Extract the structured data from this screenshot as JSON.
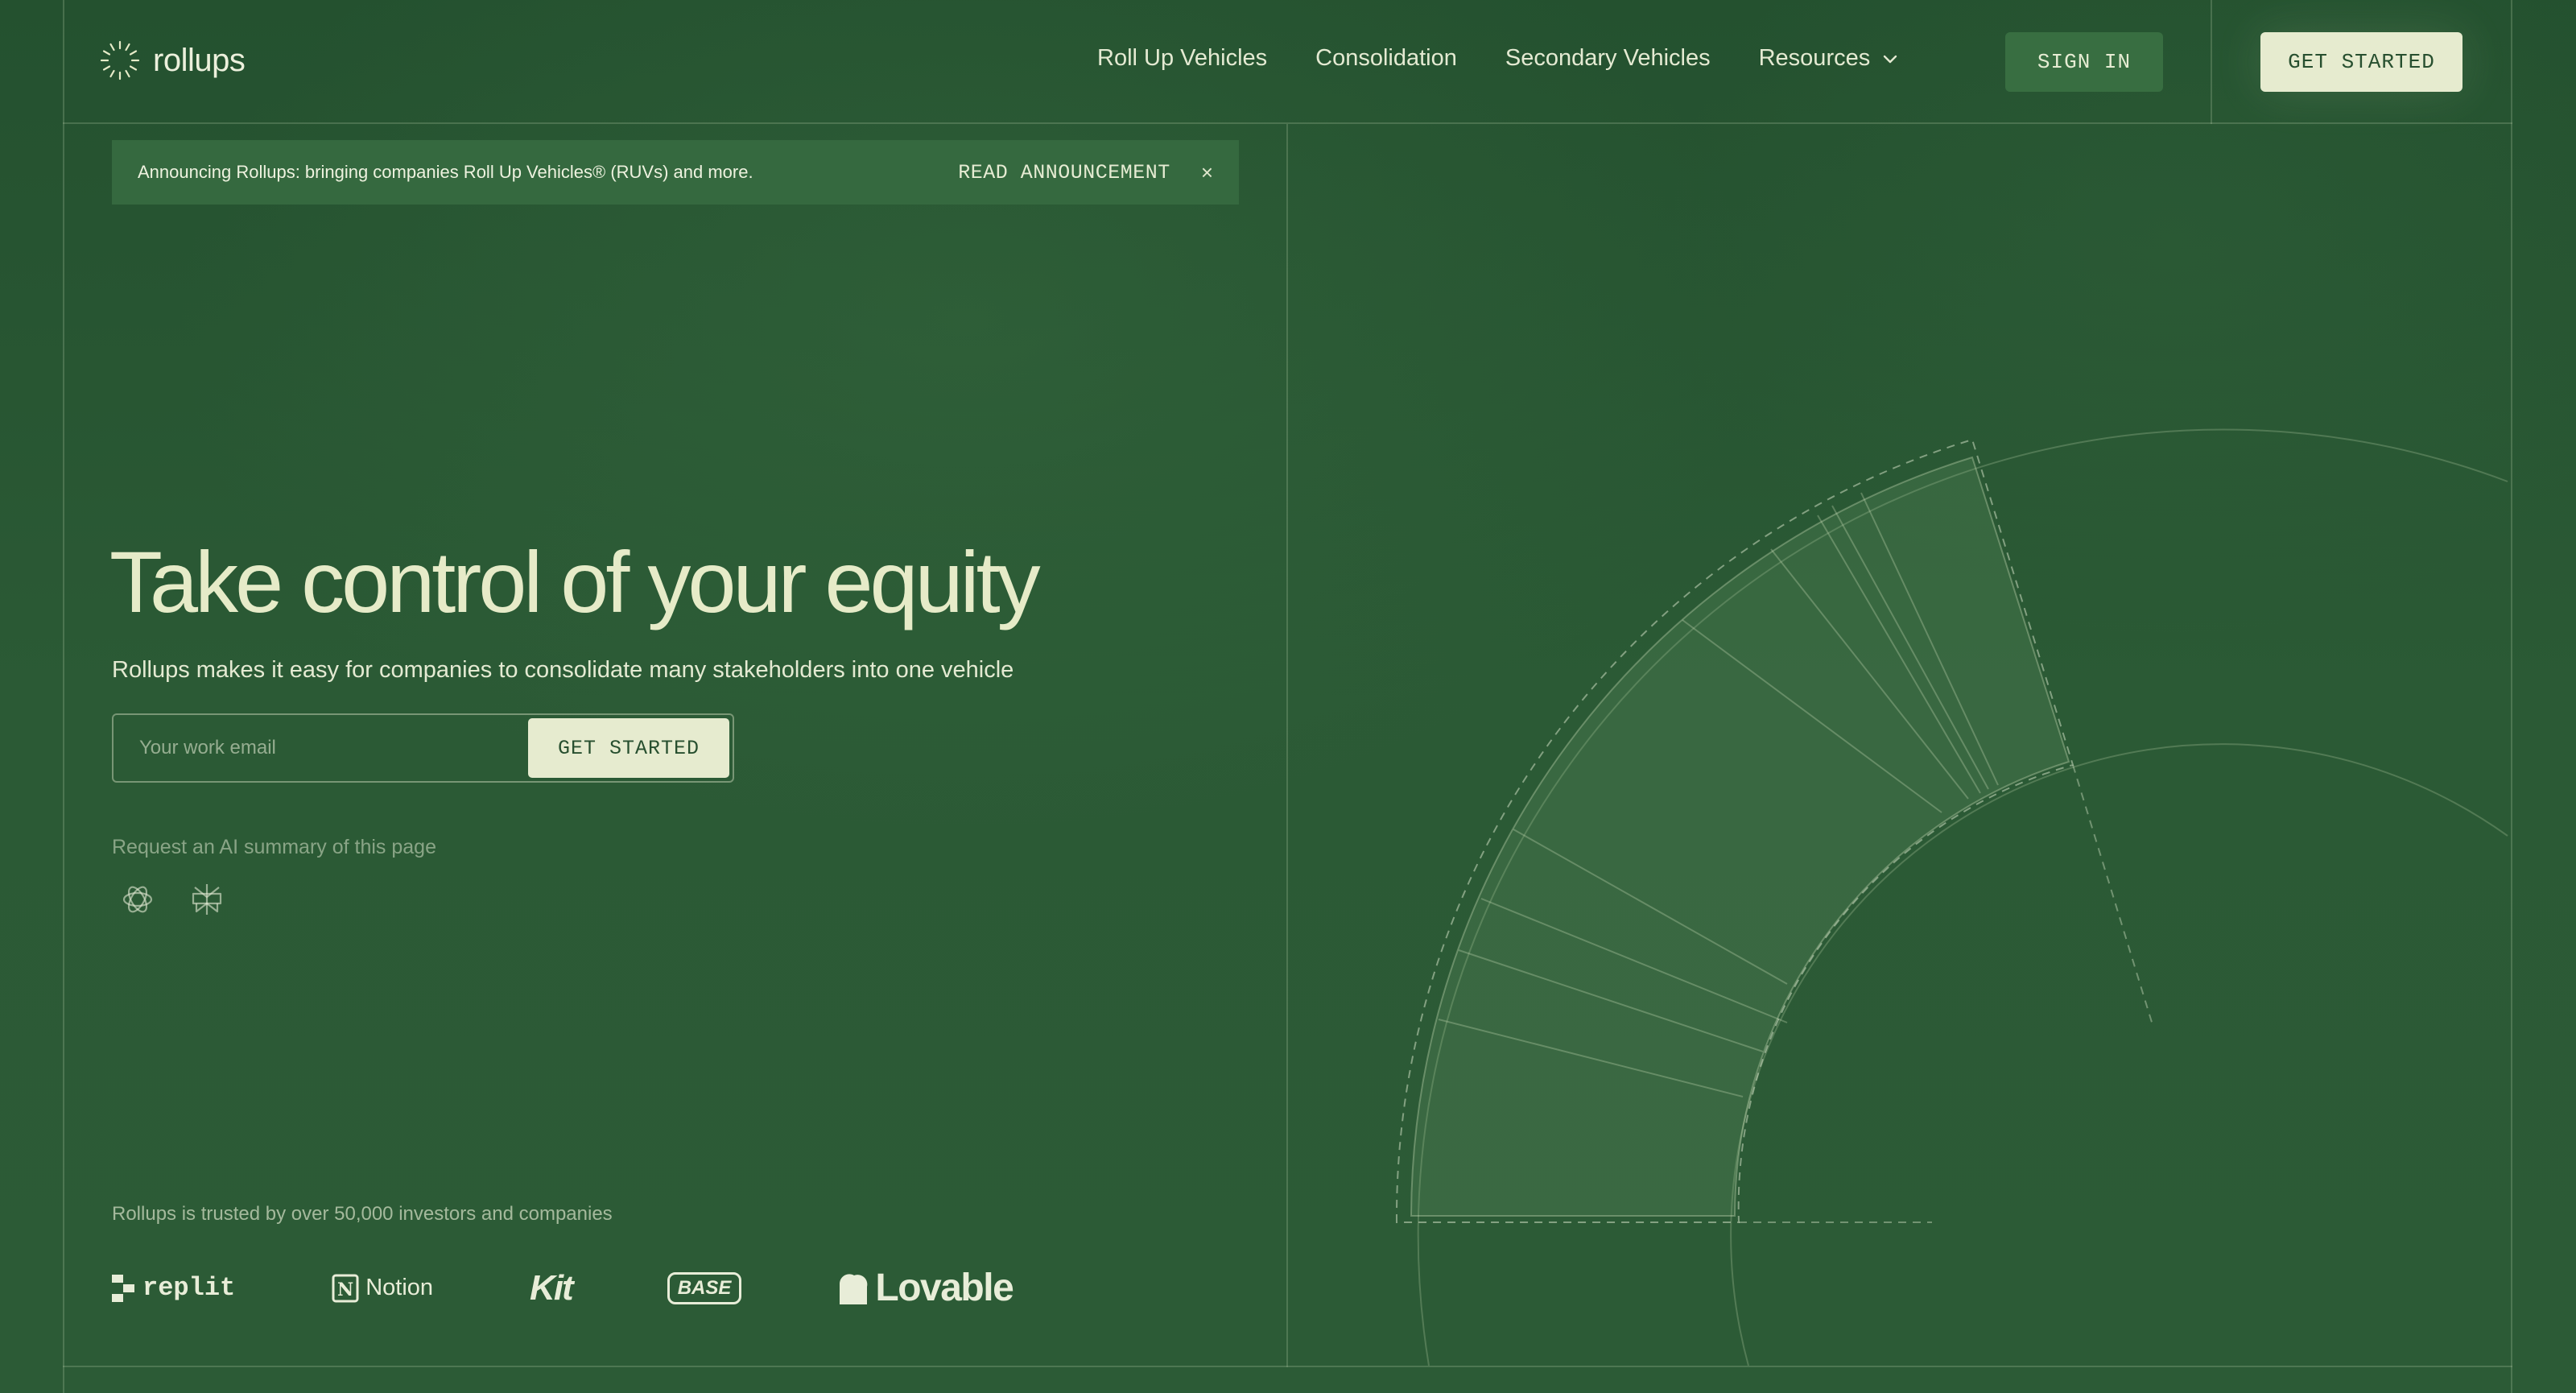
{
  "brand": {
    "name": "rollups"
  },
  "nav": {
    "items": [
      "Roll Up Vehicles",
      "Consolidation",
      "Secondary Vehicles"
    ],
    "resources_label": "Resources",
    "sign_in": "SIGN IN",
    "get_started": "GET STARTED"
  },
  "announcement": {
    "text": "Announcing Rollups: bringing companies Roll Up Vehicles® (RUVs) and more.",
    "link": "READ ANNOUNCEMENT",
    "close": "×"
  },
  "hero": {
    "title": "Take control of your equity",
    "subtitle": "Rollups makes it easy for companies to consolidate many stakeholders into one vehicle",
    "email_placeholder": "Your work email",
    "cta": "GET STARTED"
  },
  "ai_summary": {
    "label": "Request an AI summary of this page",
    "icons": [
      "openai-icon",
      "perplexity-icon"
    ]
  },
  "trusted": {
    "text": "Rollups is trusted by over 50,000 investors and companies",
    "logos": [
      "replit",
      "Notion",
      "Kit",
      "BASE",
      "Lovable"
    ]
  },
  "colors": {
    "background": "#2a5634",
    "accent_button": "#e6ebcf",
    "secondary_button": "#386e41",
    "title": "#e6ebc8"
  }
}
